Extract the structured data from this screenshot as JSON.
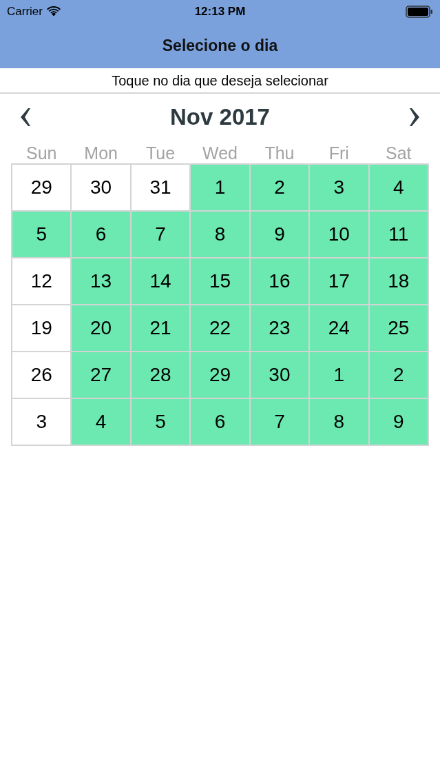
{
  "status_bar": {
    "carrier": "Carrier",
    "time": "12:13 PM"
  },
  "nav_bar": {
    "title": "Selecione o dia"
  },
  "instruction": "Toque no dia que deseja selecionar",
  "calendar": {
    "month": "Nov 2017",
    "weekdays": [
      "Sun",
      "Mon",
      "Tue",
      "Wed",
      "Thu",
      "Fri",
      "Sat"
    ],
    "weeks": [
      {
        "days": [
          {
            "day": "29",
            "available": false
          },
          {
            "day": "30",
            "available": false
          },
          {
            "day": "31",
            "available": false
          },
          {
            "day": "1",
            "available": true
          },
          {
            "day": "2",
            "available": true
          },
          {
            "day": "3",
            "available": true
          },
          {
            "day": "4",
            "available": true
          }
        ]
      },
      {
        "days": [
          {
            "day": "5",
            "available": true
          },
          {
            "day": "6",
            "available": true
          },
          {
            "day": "7",
            "available": true
          },
          {
            "day": "8",
            "available": true
          },
          {
            "day": "9",
            "available": true
          },
          {
            "day": "10",
            "available": true
          },
          {
            "day": "11",
            "available": true
          }
        ]
      },
      {
        "days": [
          {
            "day": "12",
            "available": false
          },
          {
            "day": "13",
            "available": true
          },
          {
            "day": "14",
            "available": true
          },
          {
            "day": "15",
            "available": true
          },
          {
            "day": "16",
            "available": true
          },
          {
            "day": "17",
            "available": true
          },
          {
            "day": "18",
            "available": true
          }
        ]
      },
      {
        "days": [
          {
            "day": "19",
            "available": false
          },
          {
            "day": "20",
            "available": true
          },
          {
            "day": "21",
            "available": true
          },
          {
            "day": "22",
            "available": true
          },
          {
            "day": "23",
            "available": true
          },
          {
            "day": "24",
            "available": true
          },
          {
            "day": "25",
            "available": true
          }
        ]
      },
      {
        "days": [
          {
            "day": "26",
            "available": false
          },
          {
            "day": "27",
            "available": true
          },
          {
            "day": "28",
            "available": true
          },
          {
            "day": "29",
            "available": true
          },
          {
            "day": "30",
            "available": true
          },
          {
            "day": "1",
            "available": true
          },
          {
            "day": "2",
            "available": true
          }
        ]
      },
      {
        "days": [
          {
            "day": "3",
            "available": false
          },
          {
            "day": "4",
            "available": true
          },
          {
            "day": "5",
            "available": true
          },
          {
            "day": "6",
            "available": true
          },
          {
            "day": "7",
            "available": true
          },
          {
            "day": "8",
            "available": true
          },
          {
            "day": "9",
            "available": true
          }
        ]
      }
    ]
  }
}
